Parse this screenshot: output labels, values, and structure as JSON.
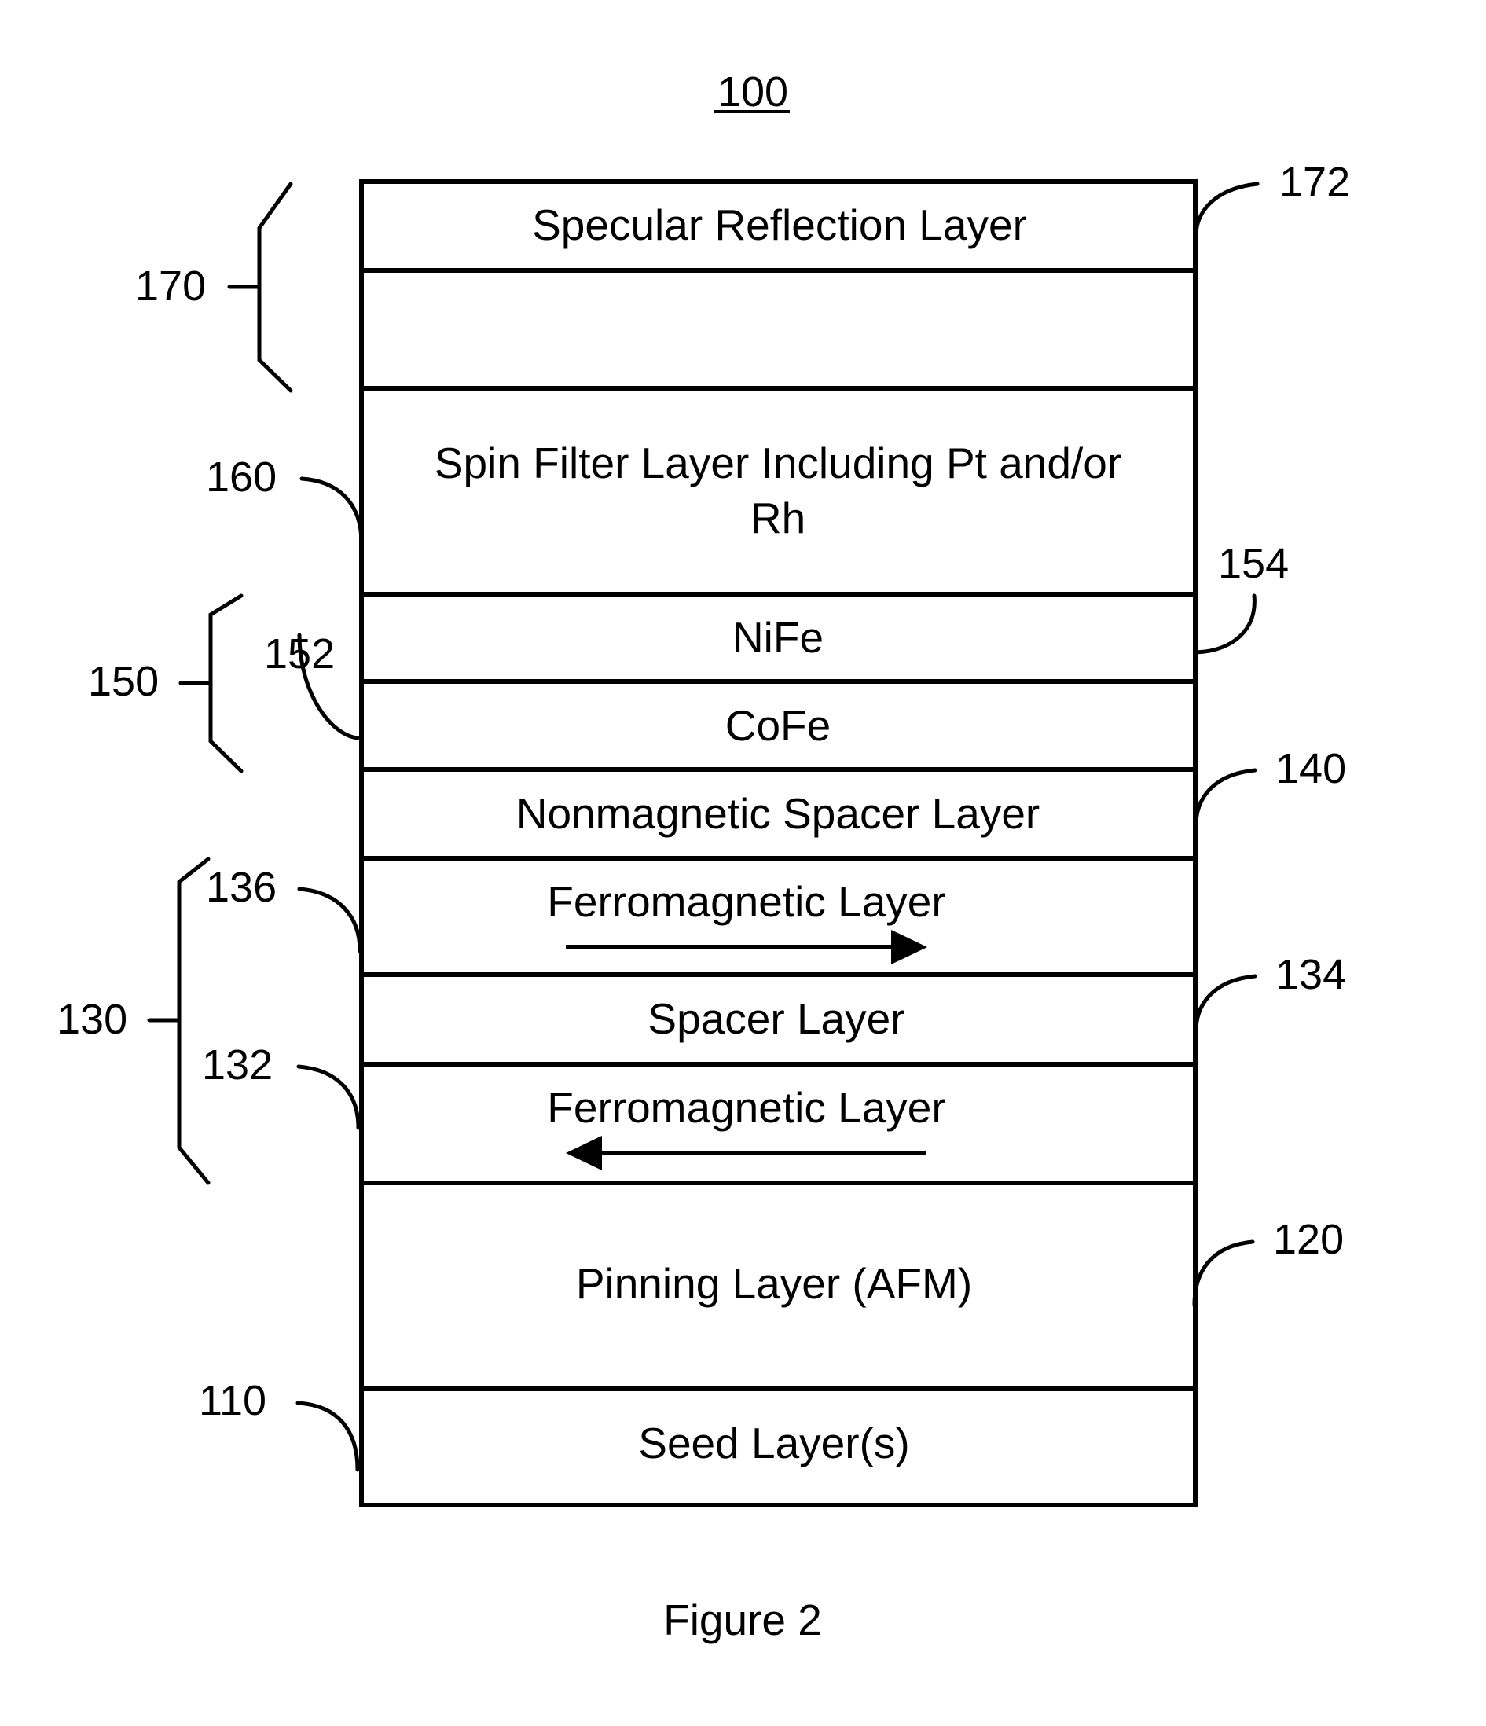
{
  "figure": {
    "number_label": "100",
    "caption": "Figure 2"
  },
  "layers": [
    {
      "ref": "172",
      "label": "Specular Reflection Layer"
    },
    {
      "ref": "",
      "label": ""
    },
    {
      "ref": "160",
      "label_line1": "Spin Filter Layer Including Pt and/or",
      "label_line2": "Rh"
    },
    {
      "ref": "154",
      "label": "NiFe"
    },
    {
      "ref": "152",
      "label": "CoFe"
    },
    {
      "ref": "140",
      "label": "Nonmagnetic Spacer Layer"
    },
    {
      "ref": "136",
      "label": "Ferromagnetic Layer",
      "magnetization": "right"
    },
    {
      "ref": "134",
      "label": "Spacer Layer"
    },
    {
      "ref": "132",
      "label": "Ferromagnetic Layer",
      "magnetization": "left"
    },
    {
      "ref": "120",
      "label": "Pinning Layer (AFM)"
    },
    {
      "ref": "110",
      "label": "Seed Layer(s)"
    }
  ],
  "groups": [
    {
      "ref": "170"
    },
    {
      "ref": "150"
    },
    {
      "ref": "130"
    }
  ]
}
